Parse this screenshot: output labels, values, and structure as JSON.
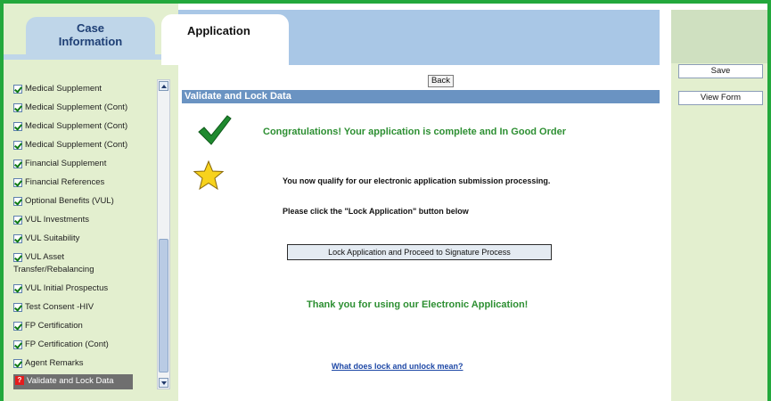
{
  "tabs": {
    "case_information": "Case\nInformation",
    "application": "Application"
  },
  "nav": {
    "items": [
      {
        "label": "Medical Supplement",
        "status": "complete"
      },
      {
        "label": "Medical Supplement (Cont)",
        "status": "complete"
      },
      {
        "label": "Medical Supplement (Cont)",
        "status": "complete"
      },
      {
        "label": "Medical Supplement (Cont)",
        "status": "complete"
      },
      {
        "label": "Financial Supplement",
        "status": "complete"
      },
      {
        "label": "Financial References",
        "status": "complete"
      },
      {
        "label": "Optional Benefits (VUL)",
        "status": "complete"
      },
      {
        "label": "VUL Investments",
        "status": "complete"
      },
      {
        "label": "VUL Suitability",
        "status": "complete"
      },
      {
        "label": "VUL Asset Transfer/Rebalancing",
        "status": "complete"
      },
      {
        "label": "VUL Initial Prospectus",
        "status": "complete"
      },
      {
        "label": "Test Consent -HIV",
        "status": "complete"
      },
      {
        "label": "FP Certification",
        "status": "complete"
      },
      {
        "label": "FP Certification (Cont)",
        "status": "complete"
      },
      {
        "label": "Agent Remarks",
        "status": "complete"
      },
      {
        "label": "Validate and Lock Data",
        "status": "active"
      }
    ],
    "active_marker": "?"
  },
  "main": {
    "back_label": "Back",
    "section_title": "Validate and Lock Data",
    "congrats": "Congratulations! Your application is complete and In Good Order",
    "qualify": "You now qualify for our electronic application submission processing.",
    "please": "Please click the \"Lock Application\" button below",
    "lock_button": "Lock Application and Proceed to Signature Process",
    "thanks": "Thank you for using our Electronic Application!",
    "lock_link": "What does lock and unlock mean?"
  },
  "side": {
    "save_label": "Save",
    "view_form_label": "View Form"
  },
  "colors": {
    "frame": "#23a83c",
    "panel": "#e3efcf",
    "band": "#a9c7e6",
    "section_bar": "#6a93c2",
    "success_text": "#2d8f32"
  },
  "icons": {
    "success": "checkmark-icon",
    "qualify": "star-icon"
  }
}
